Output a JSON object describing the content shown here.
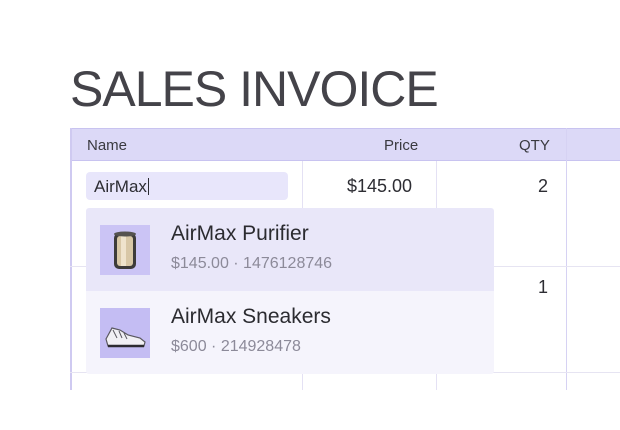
{
  "title": "SALES INVOICE",
  "table": {
    "columns": [
      "Name",
      "Price",
      "QTY"
    ],
    "rows": [
      {
        "name_input": "AirMax",
        "price": "$145.00",
        "qty": "2"
      },
      {
        "qty": "1"
      }
    ]
  },
  "dropdown": {
    "options": [
      {
        "name": "AirMax Purifier",
        "meta": "$145.00 · 1476128746",
        "icon": "purifier-icon",
        "highlighted": true
      },
      {
        "name": "AirMax Sneakers",
        "meta": "$600 · 214928478",
        "icon": "sneaker-icon",
        "highlighted": false
      }
    ]
  },
  "colors": {
    "header_bg": "#dcd9f7",
    "input_bg": "#e8e6fb",
    "highlight_bg": "#e9e7f9"
  }
}
